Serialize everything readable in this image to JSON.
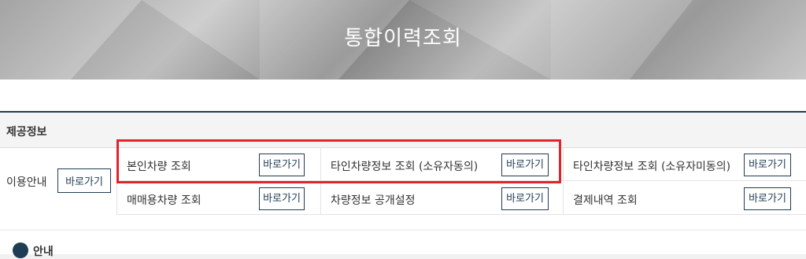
{
  "header": {
    "title": "통합이력조회"
  },
  "section": {
    "title": "제공정보"
  },
  "usage": {
    "label": "이용안내",
    "button": "바로가기"
  },
  "services": {
    "own_vehicle": {
      "label": "본인차량 조회",
      "button": "바로가기"
    },
    "other_vehicle_consent": {
      "label": "타인차량정보 조회 (소유자동의)",
      "button": "바로가기"
    },
    "other_vehicle_no_consent": {
      "label": "타인차량정보 조회 (소유자미동의)",
      "button": "바로가기"
    },
    "sale_vehicle": {
      "label": "매매용차량 조회",
      "button": "바로가기"
    },
    "public_setting": {
      "label": "차량정보 공개설정",
      "button": "바로가기"
    },
    "payment_history": {
      "label": "결제내역 조회",
      "button": "바로가기"
    }
  },
  "notice": {
    "label": "안내"
  },
  "colors": {
    "accent": "#1f3c55",
    "highlight": "#e0242b"
  }
}
